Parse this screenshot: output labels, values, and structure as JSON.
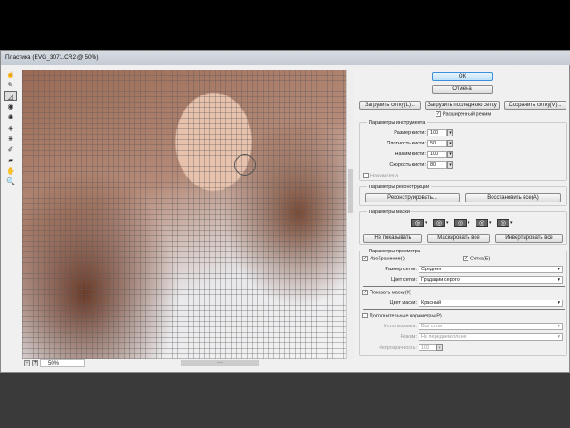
{
  "window": {
    "title": "Пластика (EVG_3071.CR2 @ 50%)"
  },
  "tools": [
    "forward-warp",
    "reconstruct",
    "smooth",
    "twirl",
    "pucker",
    "bloat",
    "push-left",
    "freeze-mask",
    "thaw-mask",
    "hand",
    "zoom"
  ],
  "status": {
    "zoom_value": "50%",
    "zoom_out": "−",
    "zoom_in": "+"
  },
  "buttons": {
    "ok": "ОК",
    "cancel": "Отмена",
    "load_mesh": "Загрузить сетку(L)...",
    "load_last_mesh": "Загрузить последнюю сетку",
    "save_mesh": "Сохранить сетку(V)..."
  },
  "advanced_mode": "Расширенный режим",
  "tool_options": {
    "title": "Параметры инструмента",
    "brush_size_label": "Размер кисти:",
    "brush_size": "100",
    "brush_density_label": "Плотность кисти:",
    "brush_density": "50",
    "brush_pressure_label": "Нажим кисти:",
    "brush_pressure": "100",
    "brush_rate_label": "Скорость кисти:",
    "brush_rate": "80",
    "stylus_pressure": "Нажим пера"
  },
  "reconstruct": {
    "title": "Параметры реконструкции",
    "reconstruct_btn": "Реконструировать...",
    "restore_all_btn": "Восстановить все(A)"
  },
  "mask": {
    "title": "Параметры маски",
    "none_btn": "Не показывать",
    "mask_all_btn": "Маскировать все",
    "invert_all_btn": "Инвертировать все"
  },
  "view": {
    "title": "Параметры просмотра",
    "image": "Изображение(I)",
    "mesh": "Сетка(E)",
    "mesh_size_label": "Размер сетки:",
    "mesh_size": "Средняя",
    "mesh_color_label": "Цвет сетки:",
    "mesh_color": "Градации серого",
    "show_mask": "Показать маску(K)",
    "mask_color_label": "Цвет маски:",
    "mask_color": "Красный",
    "backdrop": "Дополнительные параметры(P)",
    "use_label": "Использовать:",
    "use": "Все слои",
    "mode_label": "Режим:",
    "mode": "На переднем плане",
    "opacity_label": "Непрозрачность:",
    "opacity": "100"
  }
}
